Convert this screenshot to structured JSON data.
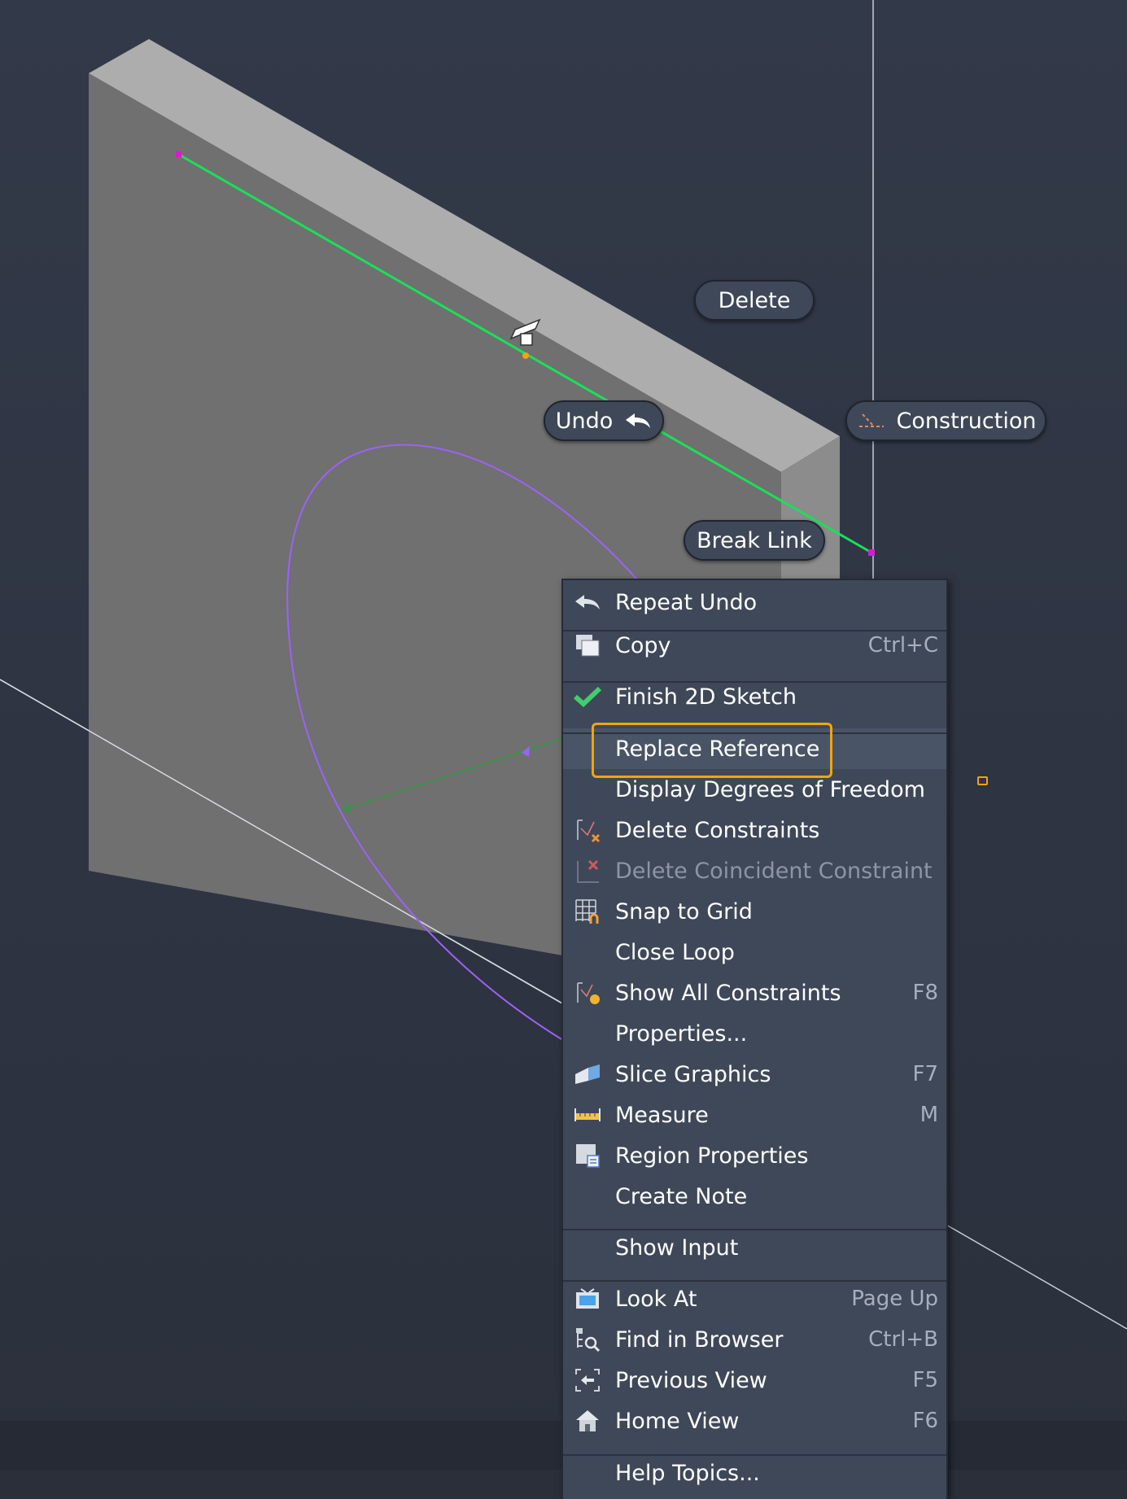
{
  "viewport": {
    "colors": {
      "background": "#2e3442",
      "part_face": "#707070",
      "part_top": "#adadad",
      "part_side": "#8a8a8a",
      "sketch_line": "#19e05a",
      "ellipse": "#9b63f5",
      "endpoint": "#d61ad6",
      "highlight": "#f2a40f"
    }
  },
  "marking_menu": {
    "delete": "Delete",
    "undo": "Undo",
    "construction": "Construction",
    "break_link": "Break Link"
  },
  "context_menu": {
    "items": [
      {
        "label": "Repeat Undo",
        "shortcut": "",
        "icon": "undo-arrow-icon"
      },
      {
        "label": "Copy",
        "shortcut": "Ctrl+C",
        "icon": "copy-icon"
      },
      {
        "label": "Finish 2D Sketch",
        "shortcut": "",
        "icon": "checkmark-icon"
      },
      {
        "label": "Replace Reference",
        "shortcut": "",
        "icon": ""
      },
      {
        "label": "Display Degrees of Freedom",
        "shortcut": "",
        "icon": ""
      },
      {
        "label": "Delete Constraints",
        "shortcut": "",
        "icon": "delete-constraints-icon"
      },
      {
        "label": "Delete Coincident Constraint",
        "shortcut": "",
        "icon": "delete-coincident-icon",
        "disabled": true
      },
      {
        "label": "Snap to Grid",
        "shortcut": "",
        "icon": "snap-grid-icon"
      },
      {
        "label": "Close Loop",
        "shortcut": "",
        "icon": ""
      },
      {
        "label": "Show All Constraints",
        "shortcut": "F8",
        "icon": "show-constraints-icon"
      },
      {
        "label": "Properties...",
        "shortcut": "",
        "icon": ""
      },
      {
        "label": "Slice Graphics",
        "shortcut": "F7",
        "icon": "slice-graphics-icon"
      },
      {
        "label": "Measure",
        "shortcut": "M",
        "icon": "measure-icon"
      },
      {
        "label": "Region Properties",
        "shortcut": "",
        "icon": "region-properties-icon"
      },
      {
        "label": "Create Note",
        "shortcut": "",
        "icon": ""
      },
      {
        "label": "Show Input",
        "shortcut": "",
        "icon": ""
      },
      {
        "label": "Look At",
        "shortcut": "Page Up",
        "icon": "look-at-icon"
      },
      {
        "label": "Find in Browser",
        "shortcut": "Ctrl+B",
        "icon": "find-browser-icon"
      },
      {
        "label": "Previous View",
        "shortcut": "F5",
        "icon": "previous-view-icon"
      },
      {
        "label": "Home View",
        "shortcut": "F6",
        "icon": "home-view-icon"
      },
      {
        "label": "Help Topics...",
        "shortcut": "",
        "icon": ""
      }
    ]
  }
}
